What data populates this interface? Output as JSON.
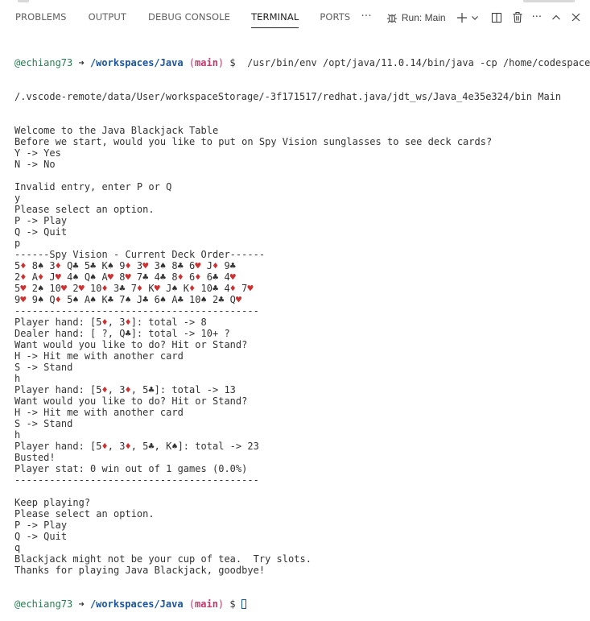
{
  "tabs": [
    {
      "label": "PROBLEMS",
      "active": false
    },
    {
      "label": "OUTPUT",
      "active": false
    },
    {
      "label": "DEBUG CONSOLE",
      "active": false
    },
    {
      "label": "TERMINAL",
      "active": true
    },
    {
      "label": "PORTS",
      "active": false
    }
  ],
  "more_tabs_glyph": "···",
  "actions": {
    "run_label": "Run: Main",
    "icons": [
      "debug-gear-icon",
      "plus-icon",
      "chevron-down-icon",
      "split-terminal-icon",
      "trash-icon",
      "more-actions-icon",
      "maximize-panel-icon",
      "close-panel-icon"
    ]
  },
  "colors": {
    "user": "#2a7a52",
    "path": "#1a55a0",
    "branch": "#c0396c",
    "red_suit": "#cd3131",
    "active_tab_underline": "#1f1f1f"
  },
  "prompt": {
    "user": "@echiang73",
    "arrow": "➜",
    "path": "/workspaces/Java",
    "branch": "main",
    "symbol": "$"
  },
  "terminal": {
    "command_line_1": "/usr/bin/env /opt/java/11.0.14/bin/java -cp /home/codespace",
    "command_line_2": "/.vscode-remote/data/User/workspaceStorage/-3f171517/redhat.java/jdt_ws/Java_4e35e324/bin Main",
    "output": [
      "Welcome to the Java Blackjack Table",
      "Before we start, would you like to put on Spy Vision sunglasses to see deck cards?",
      "Y -> Yes",
      "N -> No",
      "",
      "Invalid entry, enter P or Q",
      "y",
      "Please select an option.",
      "P -> Play",
      "Q -> Quit",
      "p",
      "------Spy Vision - Current Deck Order------",
      "5♦ 8♠ 3♦ Q♣ 5♣ K♠ 9♦ 3♥ 3♠ 8♣ 6♥ J♦ 9♣",
      "2♦ A♦ J♥ 4♠ Q♠ A♥ 8♥ 7♣ 4♣ 8♦ 6♦ 6♣ 4♥",
      "5♥ 2♠ 10♥ 2♥ 10♦ 3♣ 7♦ K♥ J♠ K♦ 10♣ 4♦ 7♥",
      "9♥ 9♠ Q♦ 5♠ A♠ K♣ 7♠ J♣ 6♠ A♣ 10♠ 2♣ Q♥",
      "------------------------------------------",
      "Player hand: [5♦, 3♦]: total -> 8",
      "Dealer hand: [ ?, Q♣]: total -> 10+ ?",
      "Want would you like to do? Hit or Stand?",
      "H -> Hit me with another card",
      "S -> Stand",
      "h",
      "Player hand: [5♦, 3♦, 5♣]: total -> 13",
      "Want would you like to do? Hit or Stand?",
      "H -> Hit me with another card",
      "S -> Stand",
      "h",
      "Player hand: [5♦, 3♦, 5♣, K♠]: total -> 23",
      "Busted!",
      "Player stat: 0 win out of 1 games (0.0%)",
      "------------------------------------------",
      "",
      "Keep playing?",
      "Please select an option.",
      "P -> Play",
      "Q -> Quit",
      "q",
      "Blackjack might not be your cup of tea.  Try slots.",
      "Thanks for playing Java Blackjack, goodbye!"
    ]
  }
}
